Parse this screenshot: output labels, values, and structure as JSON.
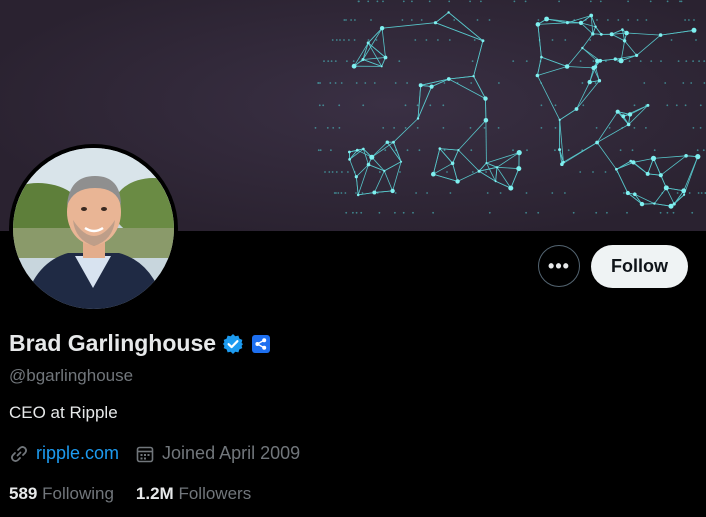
{
  "banner": {
    "description_icon": "network-globe"
  },
  "profile": {
    "name": "Brad Garlinghouse",
    "handle": "@bgarlinghouse",
    "bio": "CEO at Ripple",
    "website": "ripple.com",
    "joined": "Joined April 2009"
  },
  "actions": {
    "more_label": "•••",
    "follow_label": "Follow"
  },
  "stats": {
    "following_count": "589",
    "following_label": "Following",
    "followers_count": "1.2M",
    "followers_label": "Followers"
  },
  "colors": {
    "background": "#000000",
    "verified_blue": "#1d9bf0",
    "affiliate_blue": "#1d6ff0",
    "link": "#1d9bf0",
    "muted_text": "#71767b",
    "follow_bg": "#eff3f4",
    "globe_cyan": "#4fd7d9"
  }
}
